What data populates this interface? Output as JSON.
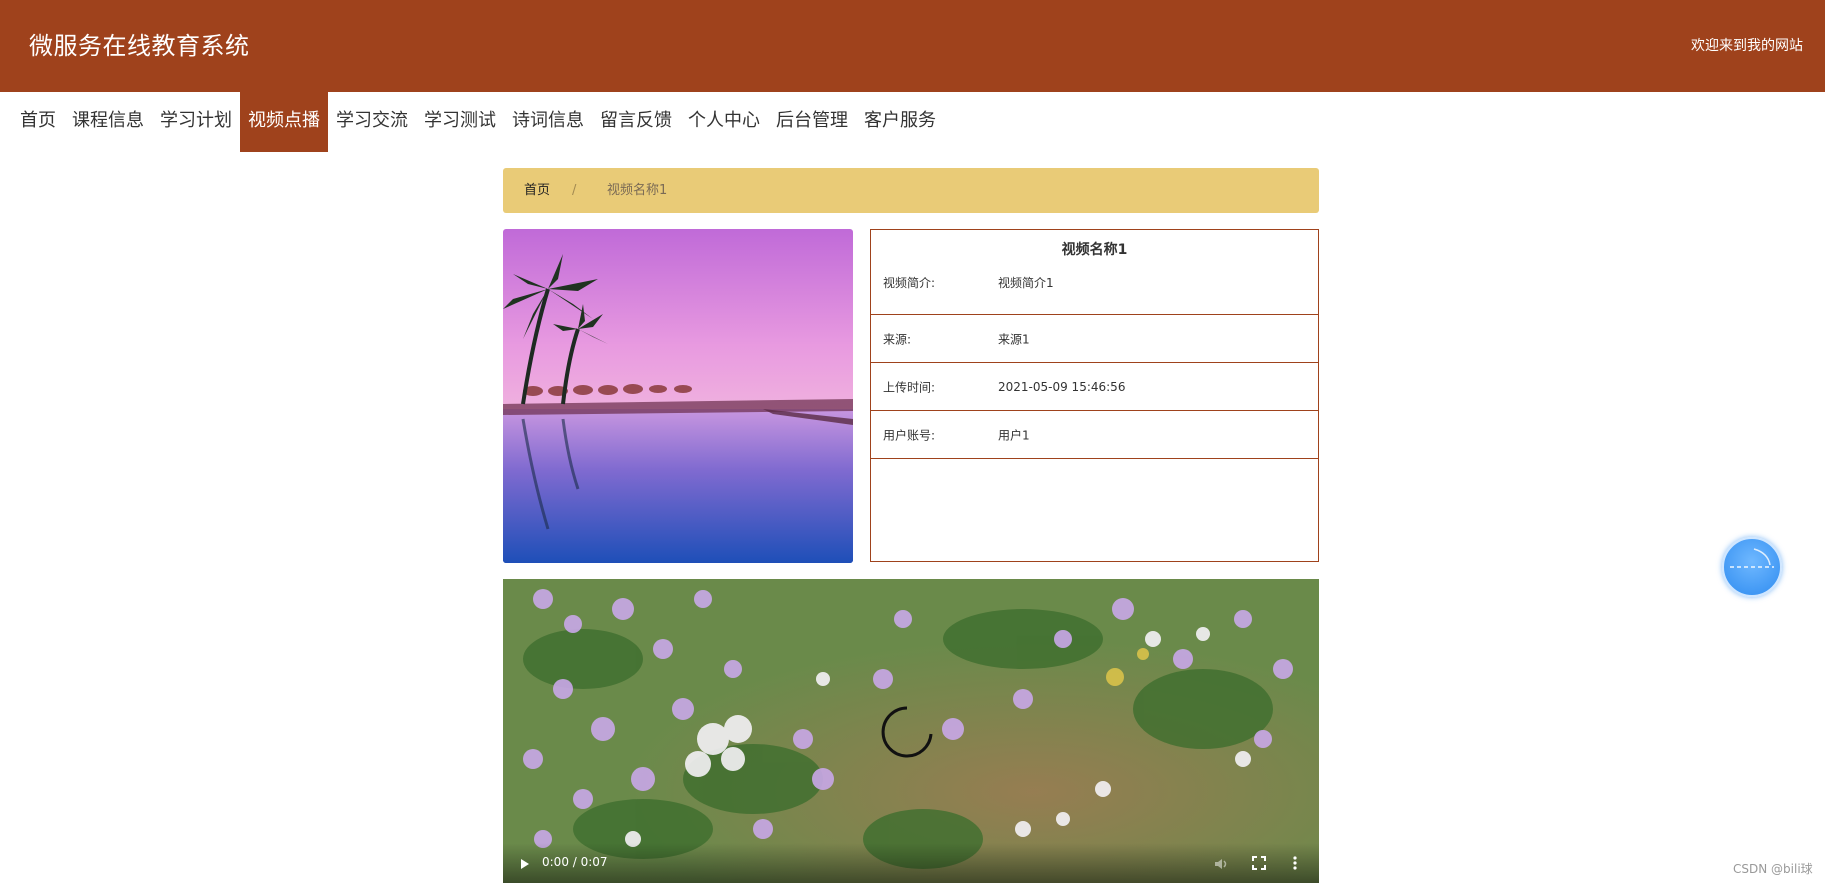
{
  "header": {
    "site_title": "微服务在线教育系统",
    "welcome": "欢迎来到我的网站",
    "color": "#9f421c"
  },
  "nav": {
    "items": [
      {
        "label": "首页",
        "active": false
      },
      {
        "label": "课程信息",
        "active": false
      },
      {
        "label": "学习计划",
        "active": false
      },
      {
        "label": "视频点播",
        "active": true
      },
      {
        "label": "学习交流",
        "active": false
      },
      {
        "label": "学习测试",
        "active": false
      },
      {
        "label": "诗词信息",
        "active": false
      },
      {
        "label": "留言反馈",
        "active": false
      },
      {
        "label": "个人中心",
        "active": false
      },
      {
        "label": "后台管理",
        "active": false
      },
      {
        "label": "客户服务",
        "active": false
      }
    ]
  },
  "breadcrumb": {
    "home": "首页",
    "separator": "/",
    "current": "视频名称1",
    "background": "#e9cb77"
  },
  "detail": {
    "title": "视频名称1",
    "rows": [
      {
        "label": "视频简介:",
        "value": "视频简介1"
      },
      {
        "label": "来源:",
        "value": "来源1"
      },
      {
        "label": "上传时间:",
        "value": "2021-05-09 15:46:56"
      },
      {
        "label": "用户账号:",
        "value": "用户1"
      }
    ]
  },
  "video": {
    "time": "0:00 / 0:07"
  },
  "watermark": "CSDN @bili球"
}
